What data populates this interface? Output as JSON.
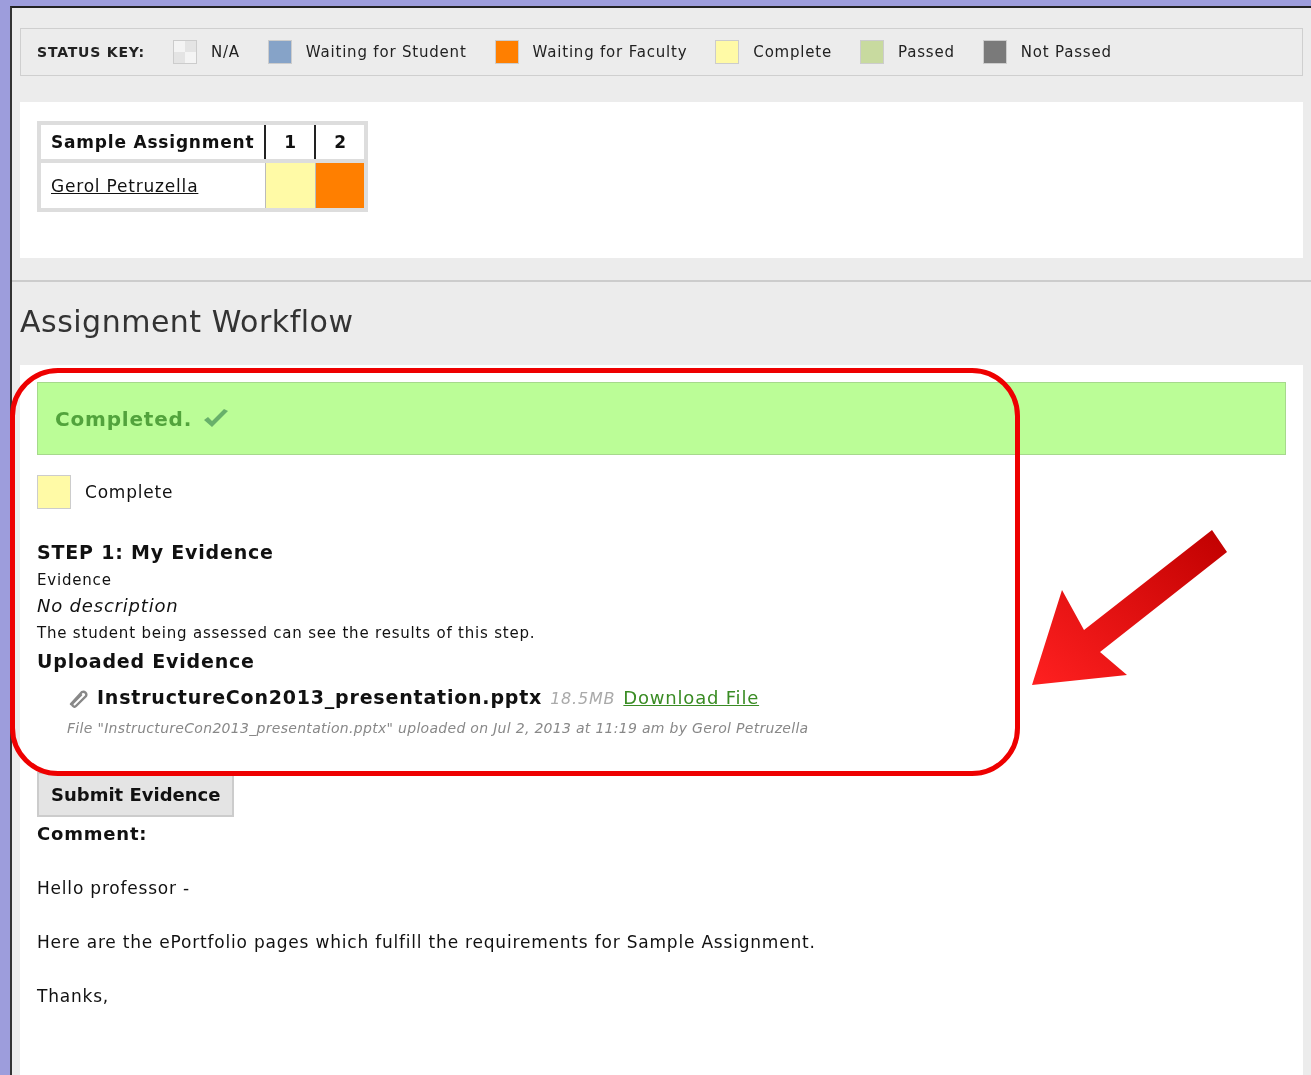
{
  "status_key": {
    "label": "STATUS KEY:",
    "items": [
      {
        "label": "N/A",
        "kind": "pattern",
        "color": "#e4e4e4"
      },
      {
        "label": "Waiting for Student",
        "kind": "solid",
        "color": "#86a3c8"
      },
      {
        "label": "Waiting for Faculty",
        "kind": "solid",
        "color": "#ff7f00"
      },
      {
        "label": "Complete",
        "kind": "solid",
        "color": "#fffaa6"
      },
      {
        "label": "Passed",
        "kind": "solid",
        "color": "#c8da9f"
      },
      {
        "label": "Not Passed",
        "kind": "solid",
        "color": "#7a7a7a"
      }
    ]
  },
  "grid": {
    "title": "Sample Assignment",
    "columns": [
      "1",
      "2"
    ],
    "rows": [
      {
        "student": "Gerol Petruzella",
        "cells": [
          {
            "color": "#fffaa6"
          },
          {
            "color": "#ff7f00"
          }
        ]
      }
    ]
  },
  "workflow": {
    "heading": "Assignment Workflow",
    "banner": "Completed.",
    "status": {
      "label": "Complete",
      "color": "#fffaa6"
    },
    "step_title": "STEP 1: My Evidence",
    "step_type": "Evidence",
    "description": "No description",
    "visibility_note": "The student being assessed can see the results of this step.",
    "uploaded_heading": "Uploaded Evidence",
    "file": {
      "name": "InstructureCon2013_presentation.pptx",
      "size": "18.5MB",
      "link": "Download File",
      "note": "File \"InstructureCon2013_presentation.pptx\" uploaded on Jul 2, 2013 at 11:19 am by Gerol Petruzella"
    },
    "submit_button": "Submit Evidence",
    "comment_label": "Comment:",
    "comment_lines": [
      "Hello professor -",
      "Here are the ePortfolio pages which fulfill the requirements for Sample Assignment.",
      "Thanks,"
    ]
  }
}
